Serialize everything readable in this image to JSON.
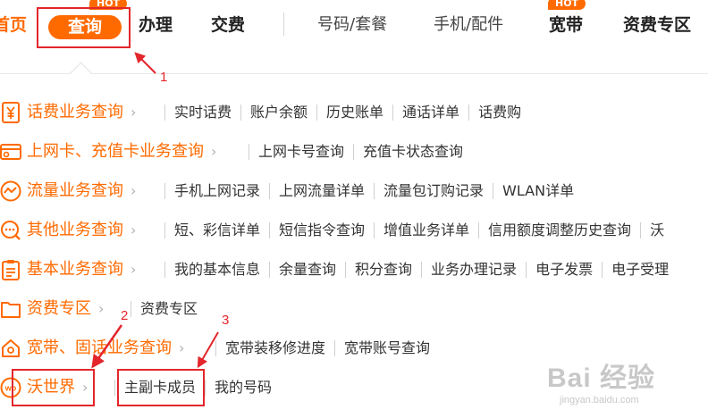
{
  "nav": {
    "home": "首页",
    "active": "查询",
    "items": [
      "办理",
      "交费"
    ],
    "secondary": [
      "号码/套餐",
      "手机/配件",
      "宽带",
      "资费专区"
    ],
    "hot_badge": "HOT"
  },
  "menu": {
    "rows": [
      {
        "icon": "yuan-receipt-icon",
        "label": "话费业务查询",
        "links": [
          "实时话费",
          "账户余额",
          "历史账单",
          "通话详单",
          "话费购"
        ]
      },
      {
        "icon": "card-icon",
        "label": "上网卡、充值卡业务查询",
        "links": [
          "上网卡号查询",
          "充值卡状态查询"
        ]
      },
      {
        "icon": "traffic-wave-icon",
        "label": "流量业务查询",
        "links": [
          "手机上网记录",
          "上网流量详单",
          "流量包订购记录",
          "WLAN详单"
        ]
      },
      {
        "icon": "message-search-icon",
        "label": "其他业务查询",
        "links": [
          "短、彩信详单",
          "短信指令查询",
          "增值业务详单",
          "信用额度调整历史查询",
          "沃"
        ]
      },
      {
        "icon": "clipboard-icon",
        "label": "基本业务查询",
        "links": [
          "我的基本信息",
          "余量查询",
          "积分查询",
          "业务办理记录",
          "电子发票",
          "电子受理"
        ]
      },
      {
        "icon": "folder-icon",
        "label": "资费专区",
        "links": [
          "资费专区"
        ]
      },
      {
        "icon": "house-icon",
        "label": "宽带、固话业务查询",
        "links": [
          "宽带装移修进度",
          "宽带账号查询"
        ]
      },
      {
        "icon": "wo-logo-icon",
        "label": "沃世界",
        "links": [
          "主副卡成员",
          "我的号码"
        ]
      }
    ]
  },
  "annotations": {
    "n1": "1",
    "n2": "2",
    "n3": "3"
  },
  "watermark": {
    "main": "Bai 经验",
    "sub": "jingyan.baidu.com"
  },
  "colors": {
    "accent": "#ff6a00",
    "annotation": "#e3262b"
  }
}
